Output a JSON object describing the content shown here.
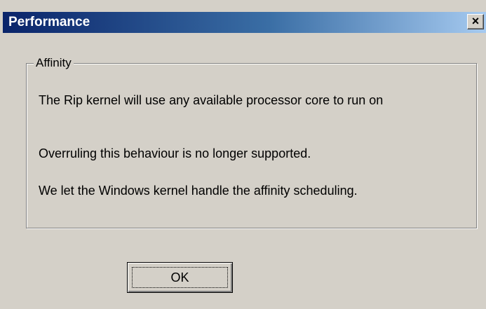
{
  "window": {
    "title": "Performance",
    "close_glyph": "×",
    "close_icon": "close-icon",
    "titlebar_gradient": [
      "#0a246a",
      "#a6caf0"
    ],
    "background": "#d4d0c8"
  },
  "group": {
    "label": "Affinity",
    "messages": [
      "The Rip kernel will use any available processor core to run on",
      "Overruling this behaviour is no longer supported.",
      "We let the Windows kernel handle the affinity scheduling."
    ]
  },
  "buttons": {
    "ok_label": "OK"
  }
}
